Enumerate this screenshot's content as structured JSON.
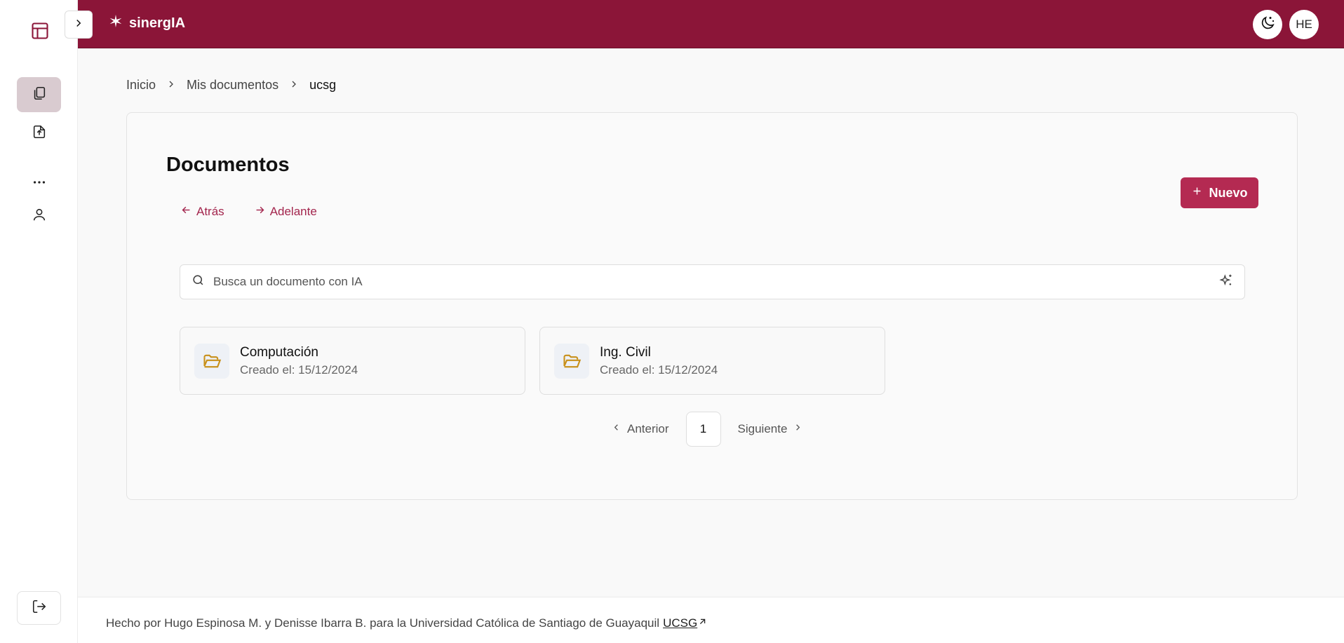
{
  "brand": {
    "name": "sinergIA",
    "accent": "#8b1538",
    "button_color": "#b42a52"
  },
  "header": {
    "avatar_initials": "HE"
  },
  "sidebar": {
    "items": [
      {
        "icon": "documents-icon"
      },
      {
        "icon": "file-upload-icon"
      },
      {
        "icon": "more-icon"
      },
      {
        "icon": "user-icon"
      }
    ],
    "logout_icon": "logout-icon"
  },
  "breadcrumb": [
    "Inicio",
    "Mis documentos",
    "ucsg"
  ],
  "main": {
    "title": "Documentos",
    "back_label": "Atrás",
    "forward_label": "Adelante",
    "new_label": "Nuevo",
    "search_placeholder": "Busca un documento con IA",
    "folders": [
      {
        "name": "Computación",
        "date": "Creado el: 15/12/2024"
      },
      {
        "name": "Ing. Civil",
        "date": "Creado el: 15/12/2024"
      }
    ],
    "pagination": {
      "prev": "Anterior",
      "page": "1",
      "next": "Siguiente"
    }
  },
  "footer": {
    "text": "Hecho por Hugo Espinosa M. y Denisse Ibarra B. para la Universidad Católica de Santiago de Guayaquil",
    "link": "UCSG"
  }
}
